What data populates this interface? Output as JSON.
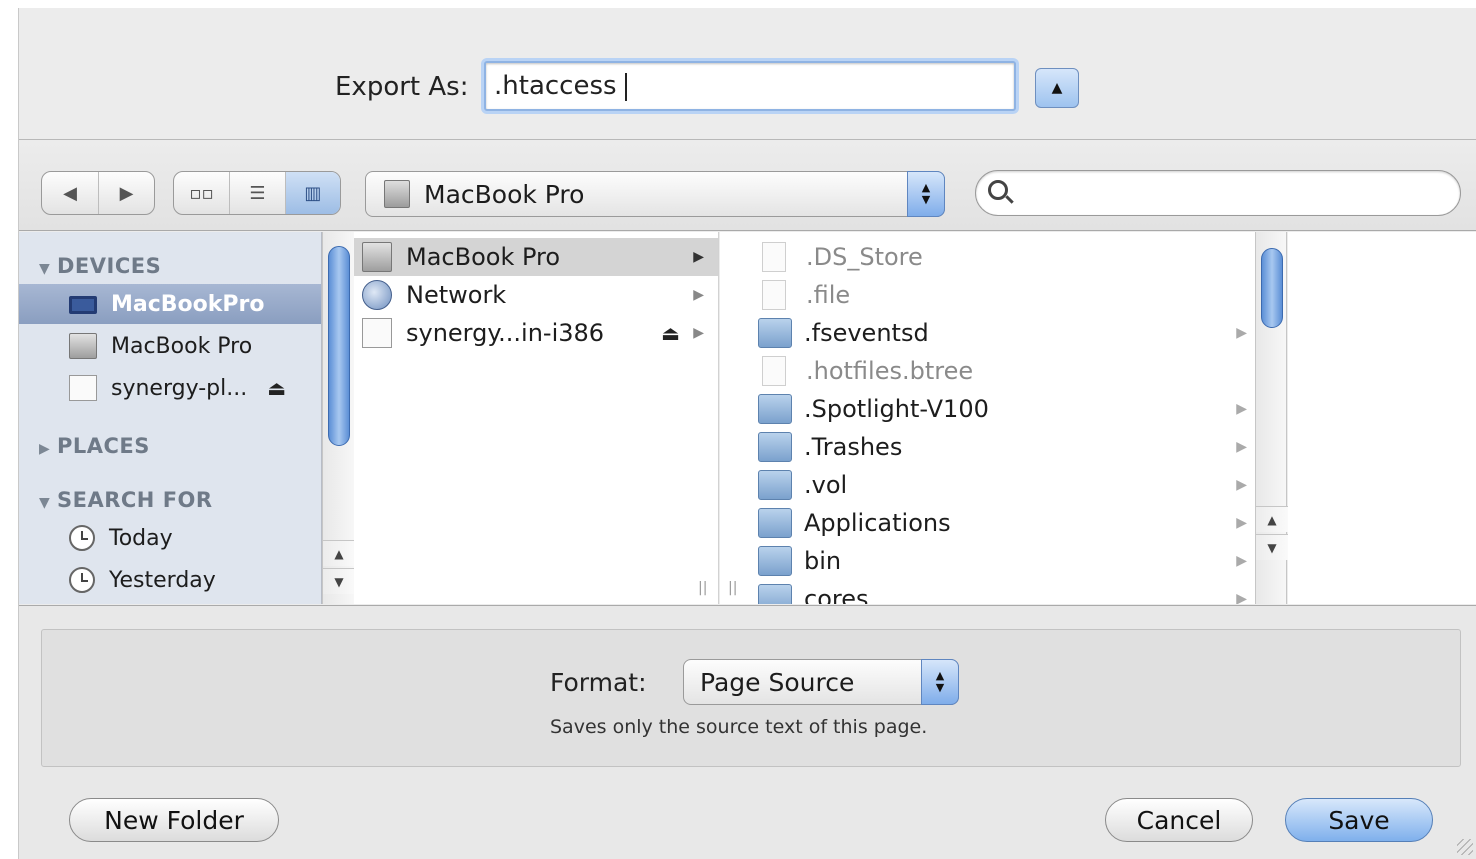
{
  "header": {
    "export_label": "Export As:",
    "filename_value": ".htaccess",
    "expand_icon": "triangle-up-icon"
  },
  "toolbar": {
    "back_icon": "◀",
    "forward_icon": "▶",
    "view_icon_label": "▫▫",
    "view_list_label": "☰",
    "view_column_label": "▥",
    "location_value": "MacBook Pro",
    "search_placeholder": ""
  },
  "sidebar": {
    "devices_heading": "DEVICES",
    "devices": [
      {
        "label": "MacBookPro",
        "icon": "laptop-icon",
        "selected": true
      },
      {
        "label": "MacBook Pro",
        "icon": "hard-drive-icon"
      },
      {
        "label": "synergy-pl...",
        "icon": "disk-image-icon",
        "eject": true
      }
    ],
    "places_heading": "PLACES",
    "search_heading": "SEARCH FOR",
    "search_items": [
      {
        "label": "Today",
        "icon": "clock-icon"
      },
      {
        "label": "Yesterday",
        "icon": "clock-icon"
      }
    ]
  },
  "column1": {
    "items": [
      {
        "label": "MacBook Pro",
        "icon": "hard-drive-icon",
        "selected": true
      },
      {
        "label": "Network",
        "icon": "network-globe-icon"
      },
      {
        "label": "synergy...in-i386",
        "icon": "disk-image-icon",
        "eject": true
      }
    ]
  },
  "column2": {
    "items": [
      {
        "label": ".DS_Store",
        "icon": "document-icon",
        "hidden": true
      },
      {
        "label": ".file",
        "icon": "document-icon",
        "hidden": true
      },
      {
        "label": ".fseventsd",
        "icon": "folder-icon"
      },
      {
        "label": ".hotfiles.btree",
        "icon": "document-icon",
        "hidden": true
      },
      {
        "label": ".Spotlight-V100",
        "icon": "folder-icon"
      },
      {
        "label": ".Trashes",
        "icon": "folder-icon"
      },
      {
        "label": ".vol",
        "icon": "folder-icon"
      },
      {
        "label": "Applications",
        "icon": "folder-icon"
      },
      {
        "label": "bin",
        "icon": "folder-icon"
      },
      {
        "label": "cores",
        "icon": "folder-icon"
      }
    ]
  },
  "options": {
    "format_label": "Format:",
    "format_value": "Page Source",
    "format_description": "Saves only the source text of this page."
  },
  "buttons": {
    "new_folder": "New Folder",
    "cancel": "Cancel",
    "save": "Save"
  }
}
